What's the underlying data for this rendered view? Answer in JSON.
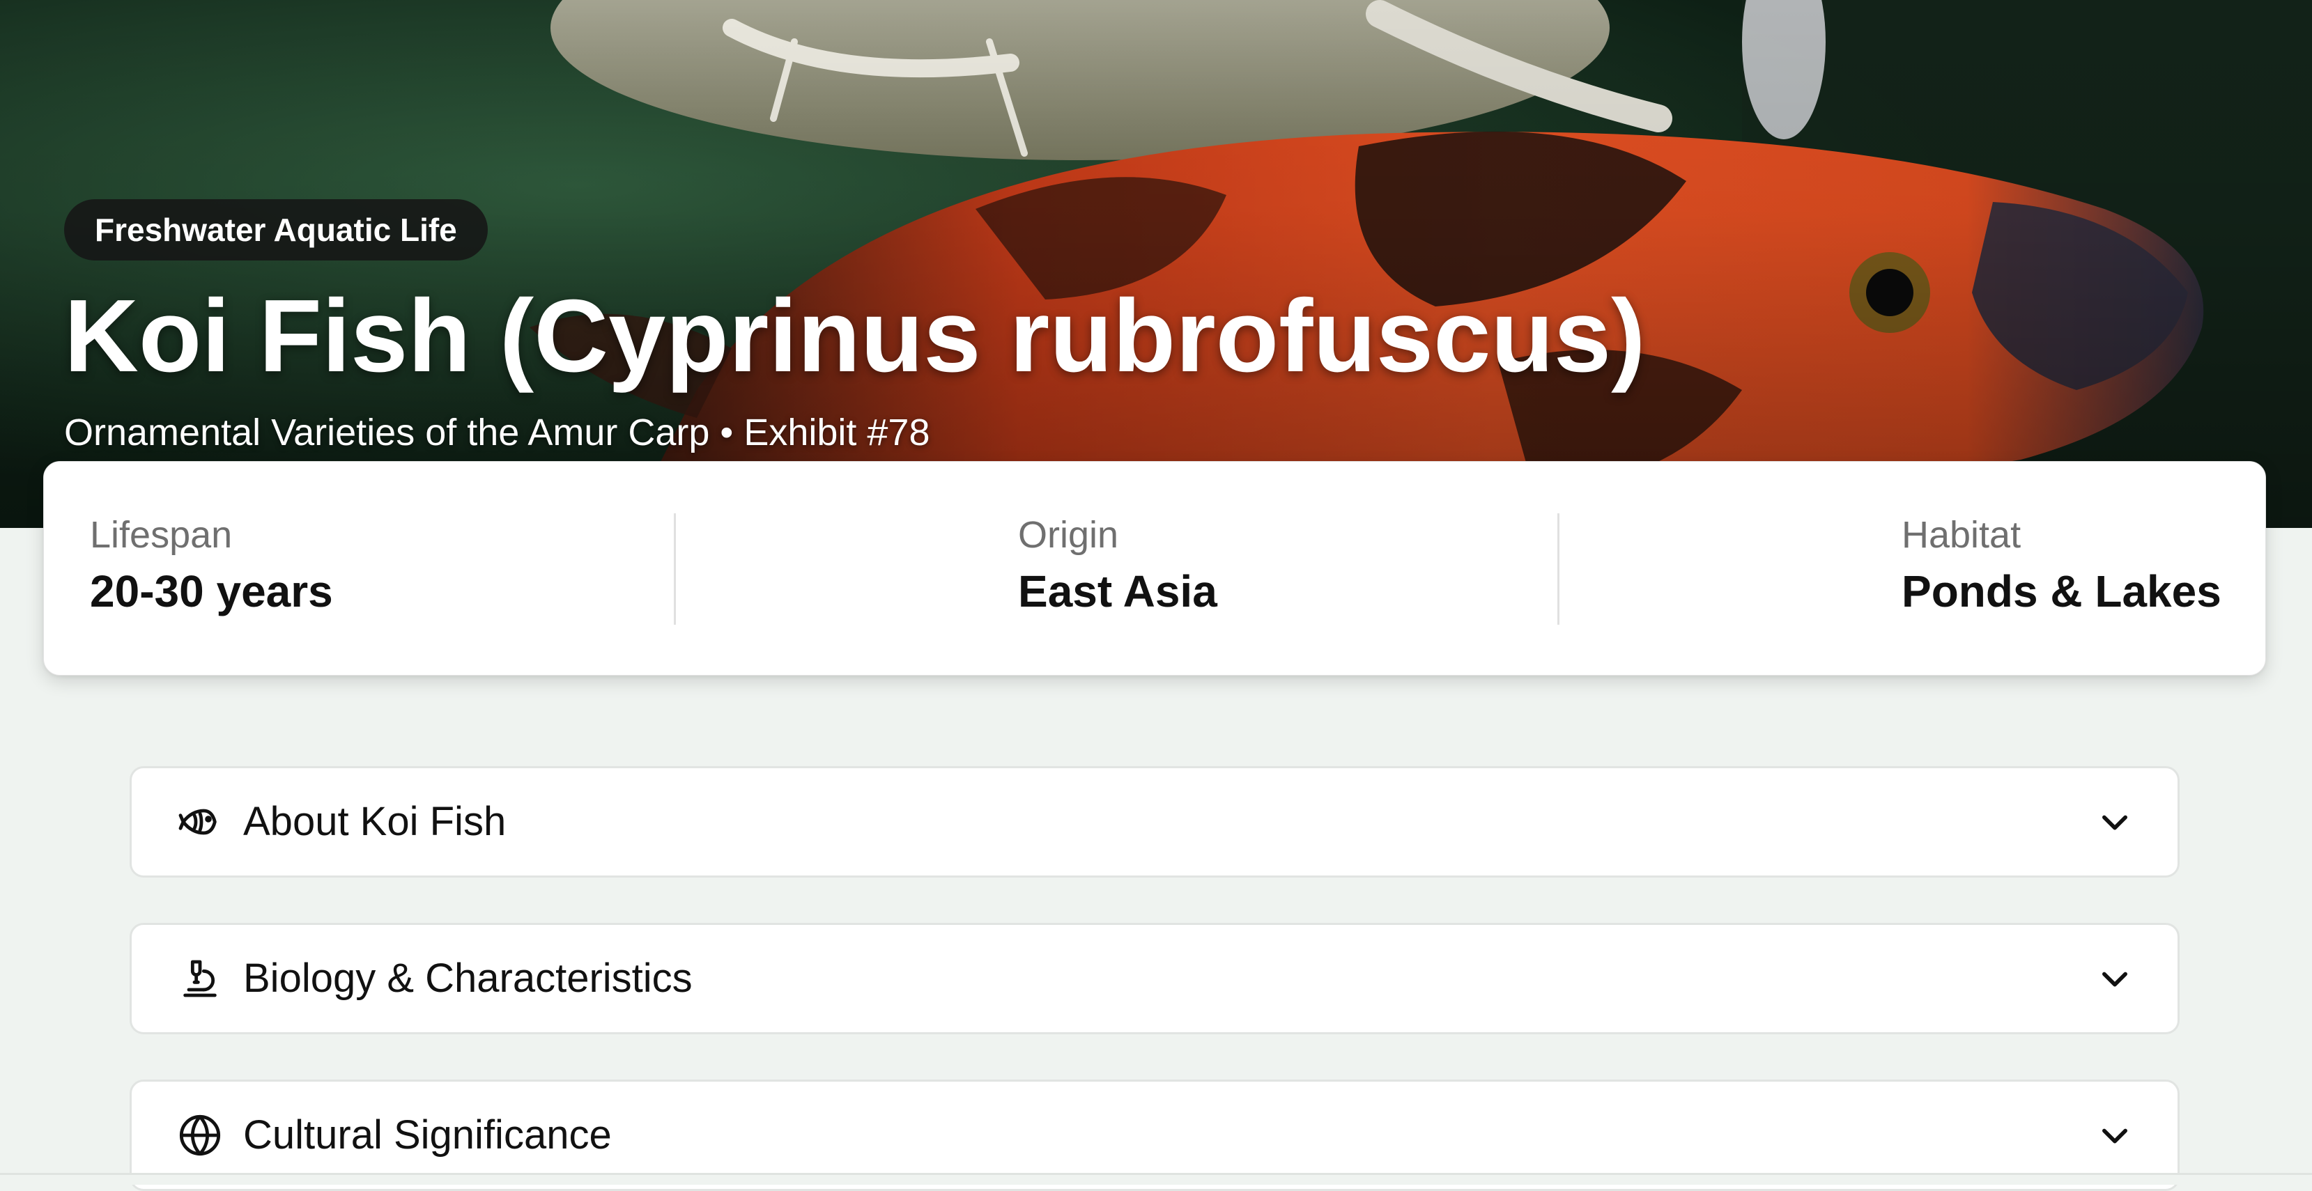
{
  "hero": {
    "category": "Freshwater Aquatic Life",
    "title": "Koi Fish (Cyprinus rubrofuscus)",
    "subtitle": "Ornamental Varieties of the Amur Carp • Exhibit #78"
  },
  "stats": [
    {
      "label": "Lifespan",
      "value": "20-30 years"
    },
    {
      "label": "Origin",
      "value": "East Asia"
    },
    {
      "label": "Habitat",
      "value": "Ponds & Lakes"
    }
  ],
  "sections": [
    {
      "title": "About Koi Fish",
      "icon": "fish-icon",
      "expanded": false
    },
    {
      "title": "Biology & Characteristics",
      "icon": "microscope-icon",
      "expanded": false
    },
    {
      "title": "Cultural Significance",
      "icon": "globe-icon",
      "expanded": false
    }
  ],
  "colors": {
    "page_background": "#eff3f0",
    "pill_background": "#161616",
    "koi_orange": "#e2461f"
  }
}
